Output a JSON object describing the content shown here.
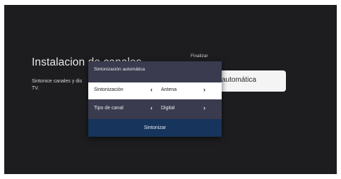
{
  "background": {
    "title": "Instalacion de canales",
    "description_lines": [
      "Sintonice canales y dis",
      "TV."
    ],
    "finalize_label": "Finalizar",
    "card_text": "automática"
  },
  "dialog": {
    "title": "Sintonización automática",
    "rows": [
      {
        "label": "Sintonización",
        "value": "Antena",
        "left_icon": "chevron-left-icon",
        "right_icon": "chevron-right-icon",
        "left_glyph": "‹",
        "right_glyph": "›"
      },
      {
        "label": "Tipo de canal",
        "value": "Digital",
        "left_icon": "chevron-left-icon",
        "right_icon": "chevron-right-icon",
        "left_glyph": "‹",
        "right_glyph": "›"
      }
    ],
    "button_label": "Sintonizar"
  },
  "colors": {
    "screen_bg": "#1d1d20",
    "dialog_bg": "#3b3b4f",
    "selected_row_bg": "#ffffff",
    "button_bg": "#16345c"
  }
}
